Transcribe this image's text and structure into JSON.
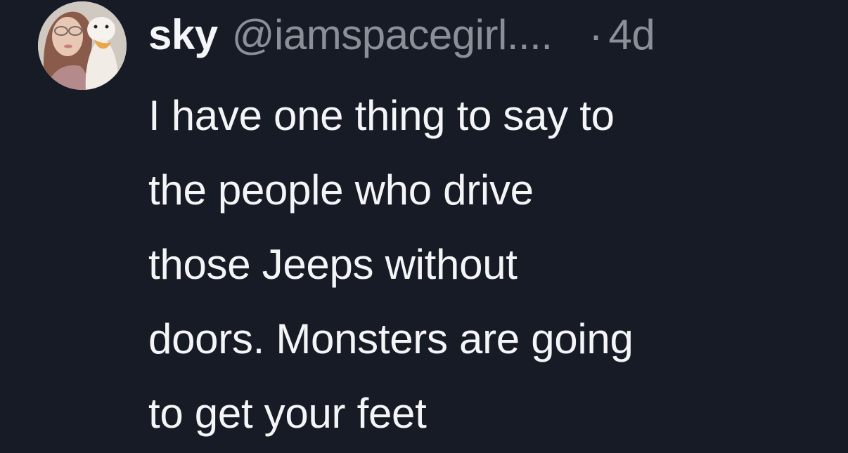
{
  "tweet": {
    "author": {
      "display_name": "sky",
      "handle": "@iamspacegirl....",
      "avatar_icon": "profile-photo-with-duck-plush"
    },
    "separator": "·",
    "timestamp": "4d",
    "text": "I have one thing to say to\nthe people who drive\nthose Jeeps without\ndoors. Monsters are going\nto get your feet"
  },
  "colors": {
    "background": "#171b26",
    "text_primary": "#f4f5f7",
    "text_secondary": "#8b8f98"
  }
}
